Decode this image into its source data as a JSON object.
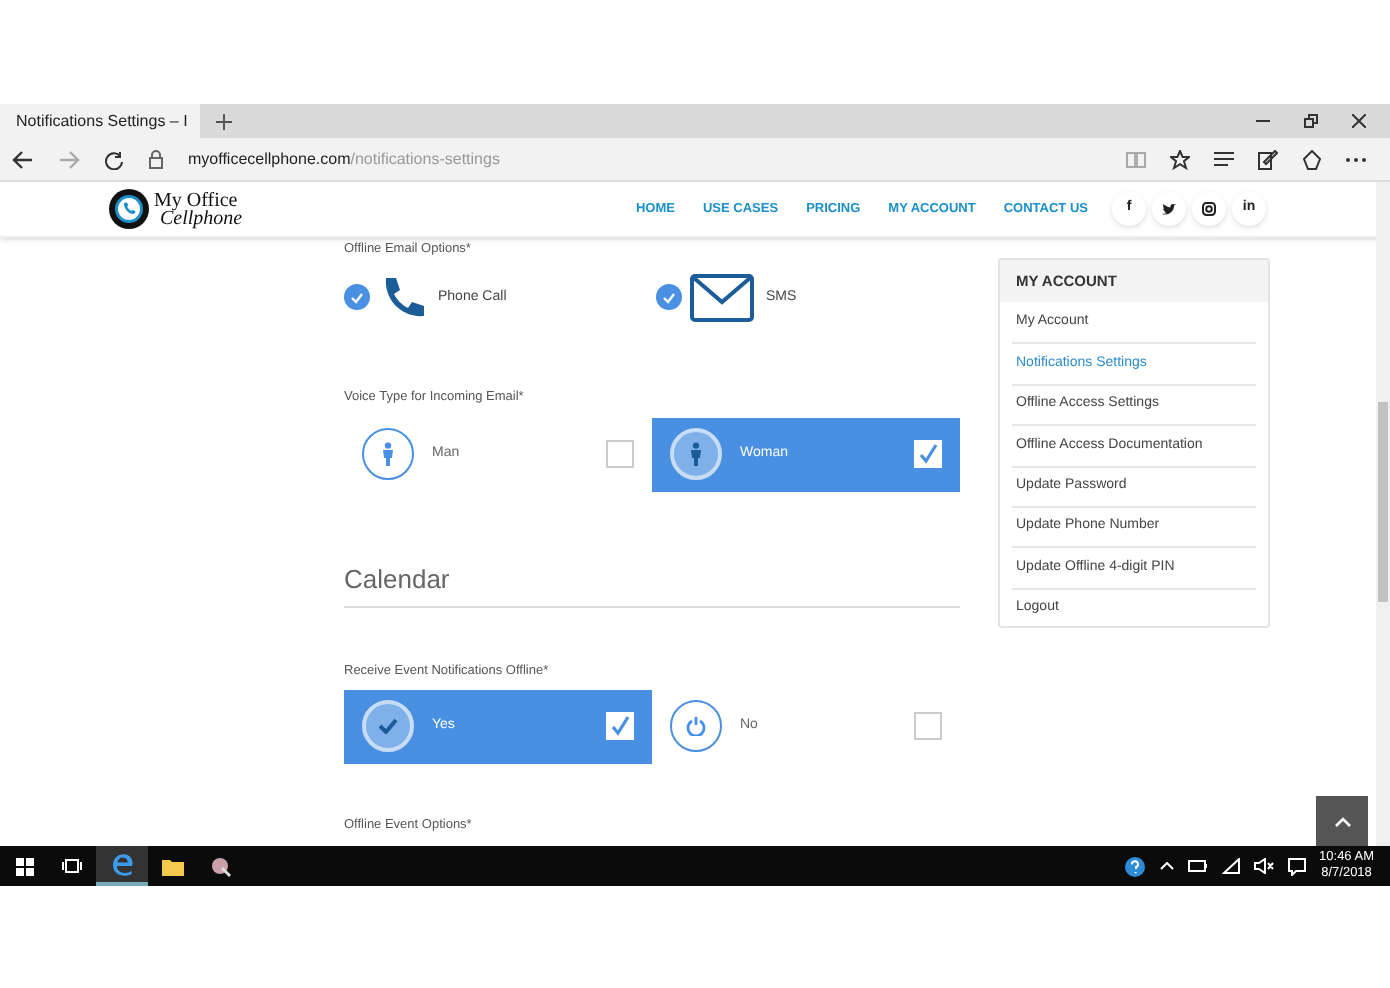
{
  "browser": {
    "tab_title": "Notifications Settings – I",
    "url_domain": "myofficecellphone.com",
    "url_path": "/notifications-settings"
  },
  "site": {
    "logo_lines": [
      "My Office",
      "Cellphone"
    ],
    "nav": [
      {
        "label": "HOME"
      },
      {
        "label": "USE CASES"
      },
      {
        "label": "PRICING"
      },
      {
        "label": "MY ACCOUNT"
      },
      {
        "label": "CONTACT US"
      }
    ],
    "social": [
      {
        "kind": "facebook",
        "glyph": "f"
      },
      {
        "kind": "twitter"
      },
      {
        "kind": "instagram"
      },
      {
        "kind": "linkedin",
        "glyph": "in"
      }
    ]
  },
  "email_options": {
    "label": "Offline Email Options*",
    "options": [
      {
        "kind": "phone",
        "label": "Phone Call",
        "checked": true
      },
      {
        "kind": "mail",
        "label": "SMS",
        "checked": true
      }
    ]
  },
  "voice_type": {
    "label": "Voice Type for Incoming Email*",
    "options": [
      {
        "kind": "person",
        "label": "Man",
        "selected": false
      },
      {
        "kind": "person",
        "label": "Woman",
        "selected": true
      }
    ]
  },
  "calendar_heading": "Calendar",
  "event_notifications": {
    "label": "Receive Event Notifications Offline*",
    "options": [
      {
        "kind": "check",
        "label": "Yes",
        "selected": true
      },
      {
        "kind": "power",
        "label": "No",
        "selected": false
      }
    ]
  },
  "next_label": "Offline Event Options*",
  "sidebar": {
    "title": "MY ACCOUNT",
    "items": [
      {
        "label": "My Account",
        "selected": false
      },
      {
        "label": "Notifications Settings",
        "selected": true
      },
      {
        "label": "Offline Access Settings",
        "selected": false
      },
      {
        "label": "Offline Access Documentation",
        "selected": false
      },
      {
        "label": "Update Password",
        "selected": false
      },
      {
        "label": "Update Phone Number",
        "selected": false
      },
      {
        "label": "Update Offline 4-digit PIN",
        "selected": false
      },
      {
        "label": "Logout",
        "selected": false
      }
    ]
  },
  "taskbar": {
    "time": "10:46 AM",
    "date": "8/7/2018"
  }
}
